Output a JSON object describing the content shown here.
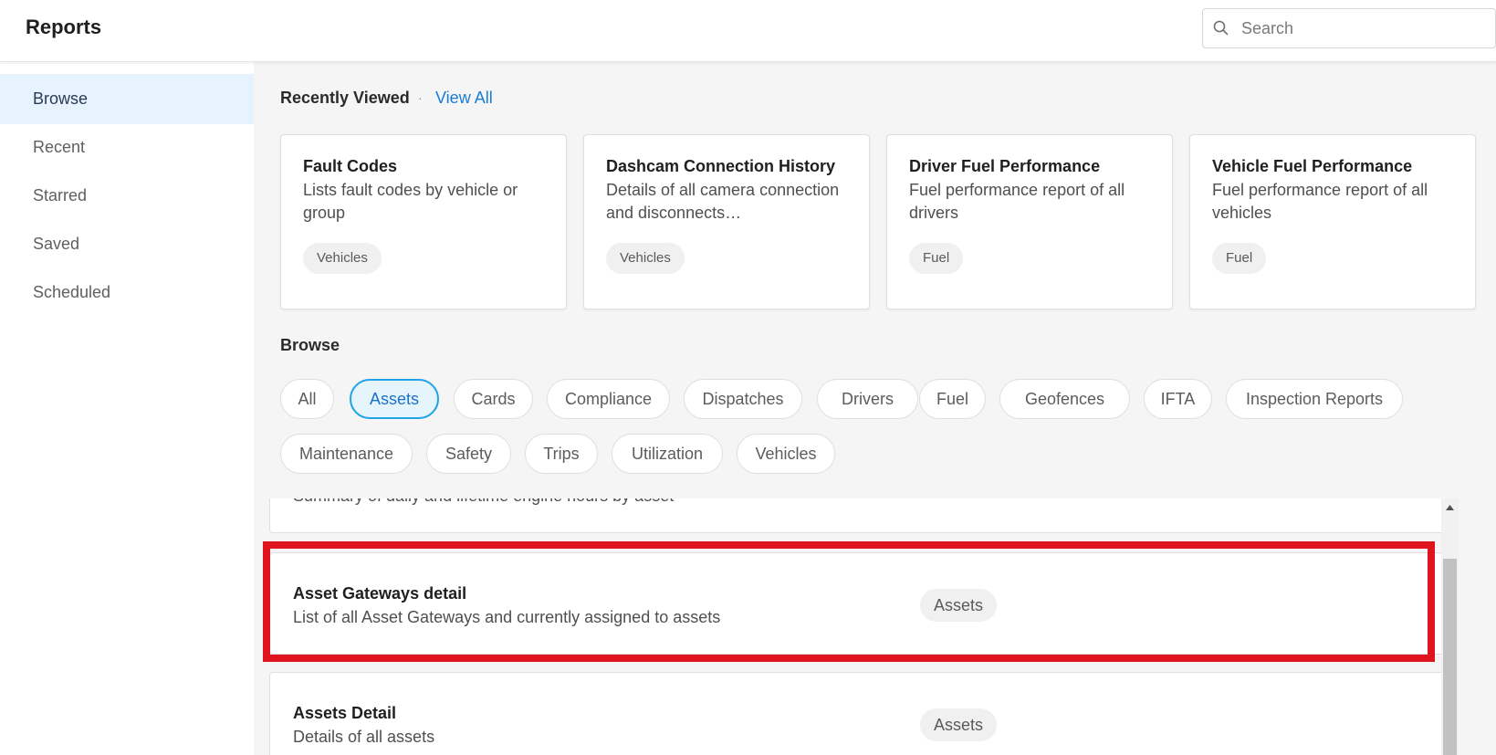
{
  "header": {
    "title": "Reports",
    "search_placeholder": "Search"
  },
  "sidebar": {
    "items": [
      {
        "label": "Browse",
        "active": true
      },
      {
        "label": "Recent"
      },
      {
        "label": "Starred"
      },
      {
        "label": "Saved"
      },
      {
        "label": "Scheduled"
      }
    ]
  },
  "recently_viewed": {
    "heading": "Recently Viewed",
    "separator": "·",
    "view_all": "View All",
    "cards": [
      {
        "title": "Fault Codes",
        "description": "Lists fault codes by vehicle or group",
        "tag": "Vehicles"
      },
      {
        "title": "Dashcam Connection History",
        "description": "Details of all camera connection and disconnects…",
        "tag": "Vehicles"
      },
      {
        "title": "Driver Fuel Performance",
        "description": "Fuel performance report of all drivers",
        "tag": "Fuel"
      },
      {
        "title": "Vehicle Fuel Performance",
        "description": "Fuel performance report of all vehicles",
        "tag": "Fuel"
      }
    ]
  },
  "browse": {
    "heading": "Browse",
    "selected_category": "Assets",
    "categories": [
      "All",
      "Assets",
      "Cards",
      "Compliance",
      "Dispatches",
      "Drivers",
      "Fuel",
      "Geofences",
      "IFTA",
      "Inspection Reports",
      "Maintenance",
      "Safety",
      "Trips",
      "Utilization",
      "Vehicles"
    ]
  },
  "reports": [
    {
      "title": "",
      "description": "Summary of daily and lifetime engine hours by asset",
      "tag": ""
    },
    {
      "title": "Asset Gateways detail",
      "description": "List of all Asset Gateways and currently assigned to assets",
      "tag": "Assets"
    },
    {
      "title": "Assets Detail",
      "description": "Details of all assets",
      "tag": "Assets"
    }
  ],
  "colors": {
    "accent": "#1b7bd6",
    "chip_selected_border": "#20a2e6",
    "highlight": "#e0141e",
    "sidebar_active_bg": "#e6f2fd"
  }
}
